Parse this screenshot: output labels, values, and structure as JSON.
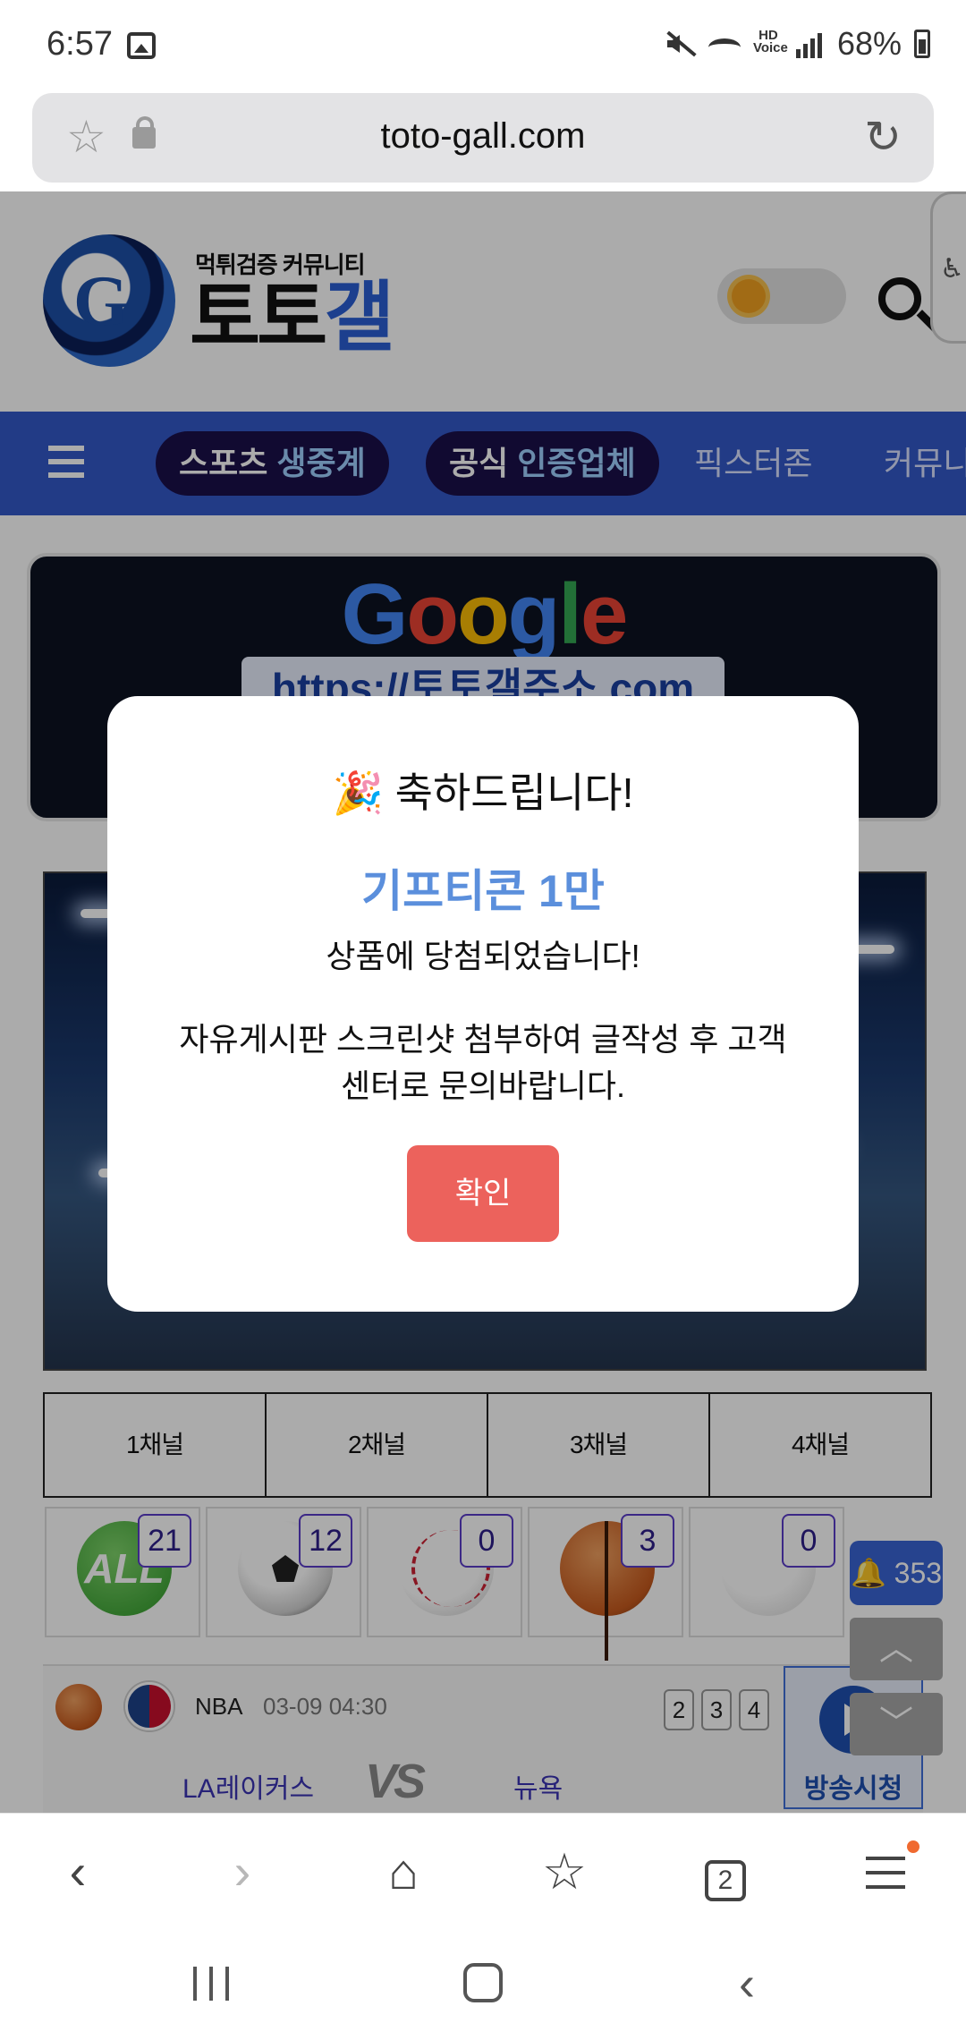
{
  "status_bar": {
    "time": "6:57",
    "battery": "68%",
    "icons": [
      "gallery-icon",
      "mute-icon",
      "wifi-icon",
      "hd-voice-icon",
      "signal-icon",
      "battery-icon"
    ],
    "hd_label": "HD\nVoice"
  },
  "browser": {
    "url": "toto-gall.com",
    "star_glyph": "☆",
    "reload_glyph": "↻"
  },
  "site": {
    "logo_tagline": "먹튀검증 커뮤니티",
    "logo_text_black": "토토",
    "logo_text_blue": "갤",
    "logo_mark": "G",
    "a11y_glyph": "♿",
    "nav": {
      "pill1_a": "스포츠",
      "pill1_b": "생중계",
      "pill2_a": "공식",
      "pill2_b": "인증업체",
      "link1": "픽스터존",
      "link2": "커뮤니"
    },
    "banner": {
      "google": [
        "G",
        "o",
        "o",
        "g",
        "l",
        "e"
      ],
      "url": "https://토토갤주소.com"
    },
    "channels": [
      "1채널",
      "2채널",
      "3채널",
      "4채널"
    ],
    "sports": [
      {
        "name": "all",
        "label": "ALL",
        "count": "21"
      },
      {
        "name": "soccer",
        "label": "",
        "count": "12"
      },
      {
        "name": "baseball",
        "label": "",
        "count": "0"
      },
      {
        "name": "basketball",
        "label": "",
        "count": "3"
      },
      {
        "name": "volleyball",
        "label": "",
        "count": "0"
      }
    ],
    "match": {
      "league": "NBA",
      "time": "03-09 04:30",
      "scores": [
        "2",
        "3",
        "4"
      ],
      "home": "LA레이커스",
      "vs": "VS",
      "away": "뉴욕",
      "broadcast": "방송시청"
    },
    "floating": {
      "bell_count": "🔔 353",
      "up": "︿",
      "down": "﹀"
    }
  },
  "modal": {
    "party_emoji": "🎉",
    "title": "축하드립니다!",
    "prize": "기프티콘 1만",
    "line1": "상품에 당첨되었습니다!",
    "line2": "자유게시판 스크린샷 첨부하여 글작성 후 고객센터로 문의바랍니다.",
    "button": "확인"
  },
  "toolbar": {
    "back": "‹",
    "forward": "›",
    "home": "⌂",
    "bookmarks": "☆",
    "tabs_count": "2"
  },
  "system_nav": {
    "back": "‹"
  },
  "colors": {
    "nav_blue": "#3358c8",
    "modal_button": "#ec625c",
    "prize_blue": "#5b8fdc",
    "badge_border": "#5a3cc8"
  }
}
